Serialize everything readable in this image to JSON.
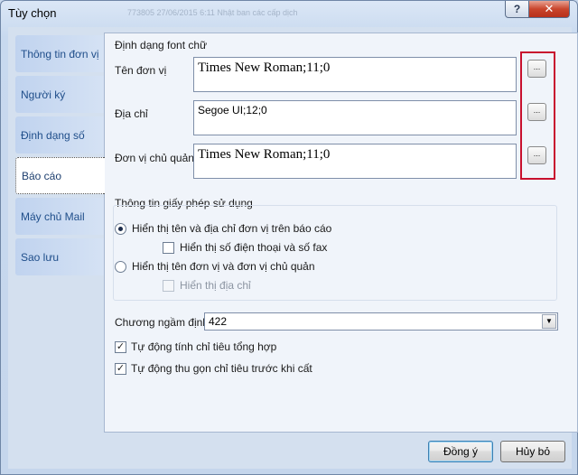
{
  "window": {
    "title": "Tùy chọn",
    "ghost_text": "773805       27/06/2015 6:11       Nhật ban các cấp dịch",
    "help_label": "?",
    "close_label": "✕"
  },
  "nav": {
    "items": [
      {
        "label": "Thông tin đơn vị",
        "active": false
      },
      {
        "label": "Người ký",
        "active": false
      },
      {
        "label": "Định dạng số",
        "active": false
      },
      {
        "label": "Báo cáo",
        "active": true
      },
      {
        "label": "Máy chủ Mail",
        "active": false
      },
      {
        "label": "Sao lưu",
        "active": false
      }
    ]
  },
  "font_group": {
    "title": "Định dạng font chữ",
    "rows": [
      {
        "label": "Tên đơn vị",
        "value": "Times New Roman;11;0",
        "button": "..."
      },
      {
        "label": "Địa chỉ",
        "value": "Segoe UI;12;0",
        "button": "..."
      },
      {
        "label": "Đơn vị chủ quản",
        "value": "Times New Roman;11;0",
        "button": "..."
      }
    ],
    "highlight_color": "#c8102e"
  },
  "license_group": {
    "title": "Thông tin giấy phép sử dụng",
    "option1": "Hiển thị tên và địa chỉ đơn vị trên báo cáo",
    "option1_sub": "Hiển thị số điện thoại và số fax",
    "option2": "Hiển thị tên đơn vị và đơn vị chủ quản",
    "option2_sub": "Hiển thị địa chỉ"
  },
  "chuong": {
    "label": "Chương ngầm định",
    "value": "422",
    "arrow": "▼"
  },
  "checks": {
    "auto_total": "Tự động tính chỉ tiêu tổng hợp",
    "auto_collapse": "Tự động thu gọn chỉ tiêu trước khi cất",
    "check_mark": "✓"
  },
  "buttons": {
    "ok": "Đồng ý",
    "cancel": "Hủy bỏ"
  },
  "colors": {
    "nav_text": "#1f4e8a",
    "window_bg": "#d4e0ef"
  }
}
